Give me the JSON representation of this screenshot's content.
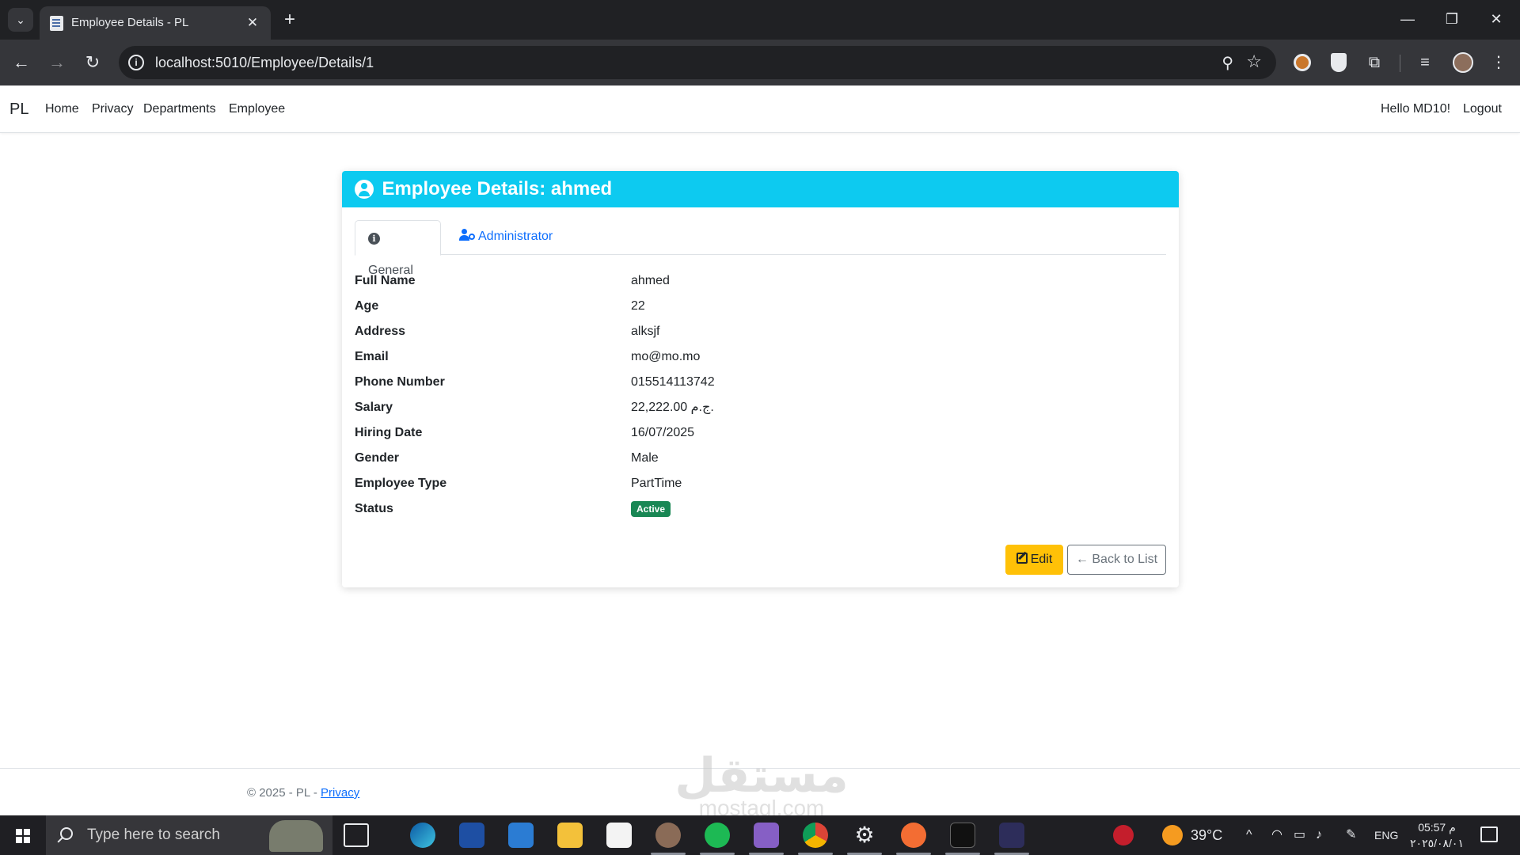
{
  "browser": {
    "tab_title": "Employee Details - PL",
    "url": "localhost:5010/Employee/Details/1"
  },
  "site": {
    "brand": "PL",
    "nav": [
      "Home",
      "Privacy",
      "Departments",
      "Employee"
    ],
    "greeting": "Hello MD10!",
    "logout": "Logout"
  },
  "card": {
    "title": "Employee Details: ahmed",
    "header_color": "#0dcaf0",
    "tabs": [
      {
        "label": "General",
        "active": true,
        "icon": "info-icon"
      },
      {
        "label": "Administrator",
        "active": false,
        "icon": "user-cog-icon"
      }
    ],
    "fields": [
      {
        "label": "Full Name",
        "value": "ahmed"
      },
      {
        "label": "Age",
        "value": "22"
      },
      {
        "label": "Address",
        "value": "alksjf"
      },
      {
        "label": "Email",
        "value": "mo@mo.mo"
      },
      {
        "label": "Phone Number",
        "value": "015514113742"
      },
      {
        "label": "Salary",
        "value": "22,222.00 ج.م."
      },
      {
        "label": "Hiring Date",
        "value": "16/07/2025"
      },
      {
        "label": "Gender",
        "value": "Male"
      },
      {
        "label": "Employee Type",
        "value": "PartTime"
      }
    ],
    "status": {
      "label": "Status",
      "value": "Active",
      "color": "#198754"
    },
    "buttons": {
      "edit": "Edit",
      "back": "Back to List"
    }
  },
  "footer": {
    "text": "© 2025 - PL - ",
    "privacy_link": "Privacy"
  },
  "watermark": {
    "main": "مستقل",
    "sub": "mostaql.com"
  },
  "taskbar": {
    "search_placeholder": "Type here to search",
    "weather": "39°C",
    "language": "ENG",
    "time": "05:57 م",
    "date": "٢٠٢٥/٠٨/٠١"
  }
}
